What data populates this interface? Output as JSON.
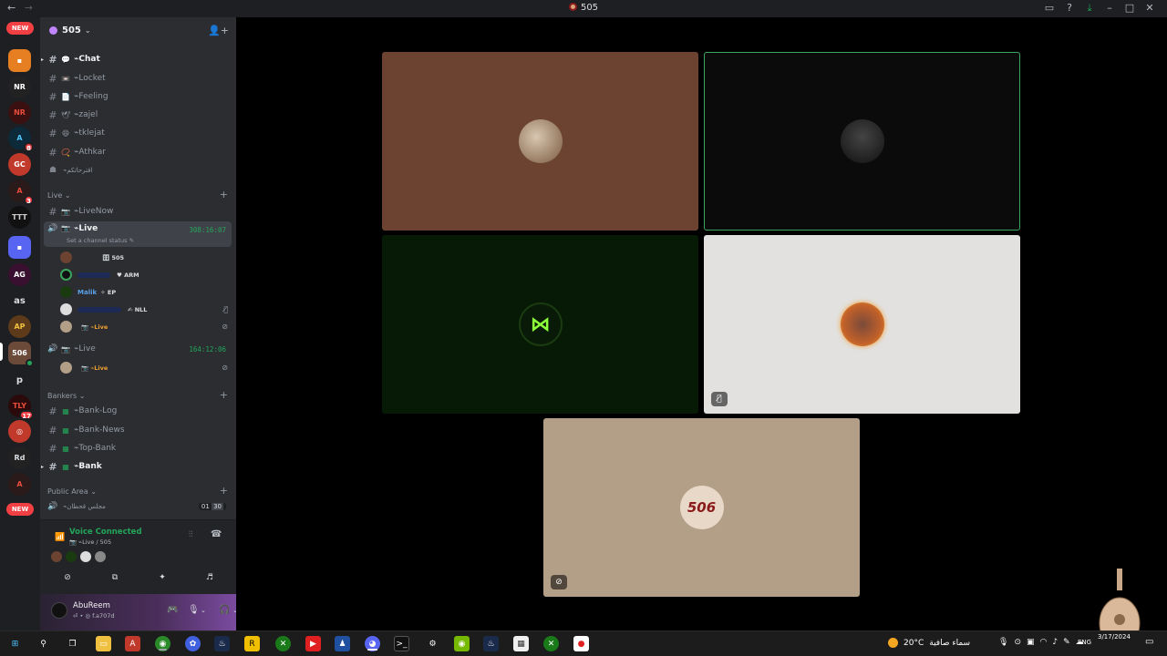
{
  "window": {
    "title": "505",
    "nav_back": "←",
    "nav_forward": "→"
  },
  "server": {
    "name": "505",
    "new_tag": "NEW",
    "rail_labels": {
      "as": "as",
      "p": "p"
    },
    "rail_badges": [
      "8",
      "3",
      "17",
      "3"
    ]
  },
  "channels_top": [
    {
      "emoji": "💬",
      "name": "Chat",
      "bold": true
    },
    {
      "emoji": "📼",
      "name": "Locket",
      "bold": false
    },
    {
      "emoji": "📄",
      "name": "Feeling",
      "bold": false
    },
    {
      "emoji": "🕊",
      "name": "zajel",
      "bold": false
    },
    {
      "emoji": "😄",
      "name": "tklejat",
      "bold": false
    },
    {
      "emoji": "📿",
      "name": "Athkar",
      "bold": false
    },
    {
      "emoji": "",
      "name": "اقترحاتكم",
      "bold": false
    }
  ],
  "categories": {
    "live": "Live",
    "bankers": "Bankers",
    "public": "Public Area"
  },
  "live_channels": {
    "livenow": "LiveNow",
    "live_active": {
      "name": "Live",
      "timer": "308:16:07",
      "status": "Set a channel status"
    },
    "live_second": {
      "name": "Live",
      "timer": "164:12:06"
    }
  },
  "voice_users_1": [
    {
      "name": "",
      "tag": "505"
    },
    {
      "name": "",
      "tag": "ARM"
    },
    {
      "name": "Malik",
      "tag": "EP"
    },
    {
      "name": "",
      "tag": "NLL"
    },
    {
      "name": "",
      "tag": "Live"
    }
  ],
  "voice_users_2": [
    {
      "name": "",
      "tag": "Live"
    }
  ],
  "bank_channels": [
    {
      "name": "Bank-Log",
      "bold": false
    },
    {
      "name": "Bank-News",
      "bold": false
    },
    {
      "name": "Top-Bank",
      "bold": false
    },
    {
      "name": "Bank",
      "bold": true
    }
  ],
  "public_channel": {
    "name": "مجلس قحطان",
    "count_a": "01",
    "count_b": "30"
  },
  "voice_panel": {
    "title": "Voice Connected",
    "subtitle": "Live / 505"
  },
  "user": {
    "name": "AbuReem",
    "sub": "f.a707d"
  },
  "taskbar": {
    "weather_temp": "20°C",
    "weather_text": "سماء صافية",
    "lang": "ENG",
    "time": "",
    "date": "3/17/2024"
  },
  "icons": {
    "titlebar": [
      "inbox-icon",
      "help-icon",
      "download-icon",
      "minimize-icon",
      "maximize-icon",
      "close-icon"
    ],
    "voice_actions": [
      "camera-off-icon",
      "screen-share-icon",
      "activities-icon",
      "soundboard-icon"
    ]
  },
  "colors": {
    "accent_green": "#23a55a",
    "tile_1": "#6b4330",
    "tile_2": "#0b0b0b",
    "tile_3": "#071a06",
    "tile_4": "#e2e1e0",
    "tile_5": "#b39e87",
    "speaking_border": "#3ba55d"
  }
}
